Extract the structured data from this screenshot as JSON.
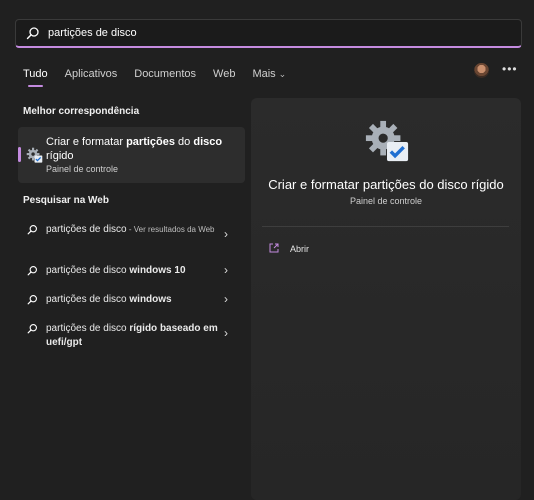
{
  "search": {
    "query": "partições de disco"
  },
  "tabs": [
    {
      "label": "Tudo"
    },
    {
      "label": "Aplicativos"
    },
    {
      "label": "Documentos"
    },
    {
      "label": "Web"
    },
    {
      "label": "Mais"
    }
  ],
  "sections": {
    "best_match": "Melhor correspondência",
    "web": "Pesquisar na Web"
  },
  "best_match": {
    "title_part1": "Criar e formatar ",
    "title_bold1": "partições",
    "title_part2": " do ",
    "title_bold2": "disco",
    "title_part3": " rígido",
    "subtitle": "Painel de controle"
  },
  "web_results": [
    {
      "normal": "partições de disco",
      "light": " - Ver resultados da Web",
      "bold": ""
    },
    {
      "normal": "partições de disco ",
      "light": "",
      "bold": "windows 10"
    },
    {
      "normal": "partições de disco ",
      "light": "",
      "bold": "windows"
    },
    {
      "normal": "partições de disco ",
      "light": "",
      "bold": "rígido baseado em uefi/gpt"
    }
  ],
  "detail": {
    "title": "Criar e formatar partições do disco rígido",
    "subtitle": "Painel de controle",
    "open_label": "Abrir"
  },
  "colors": {
    "accent": "#c48be0",
    "background": "#202020",
    "panel": "#2b2b2b"
  },
  "icons": [
    "search-icon",
    "chevron-down-icon",
    "avatar",
    "more-icon",
    "gear-check-icon",
    "chevron-right-icon",
    "open-icon"
  ]
}
